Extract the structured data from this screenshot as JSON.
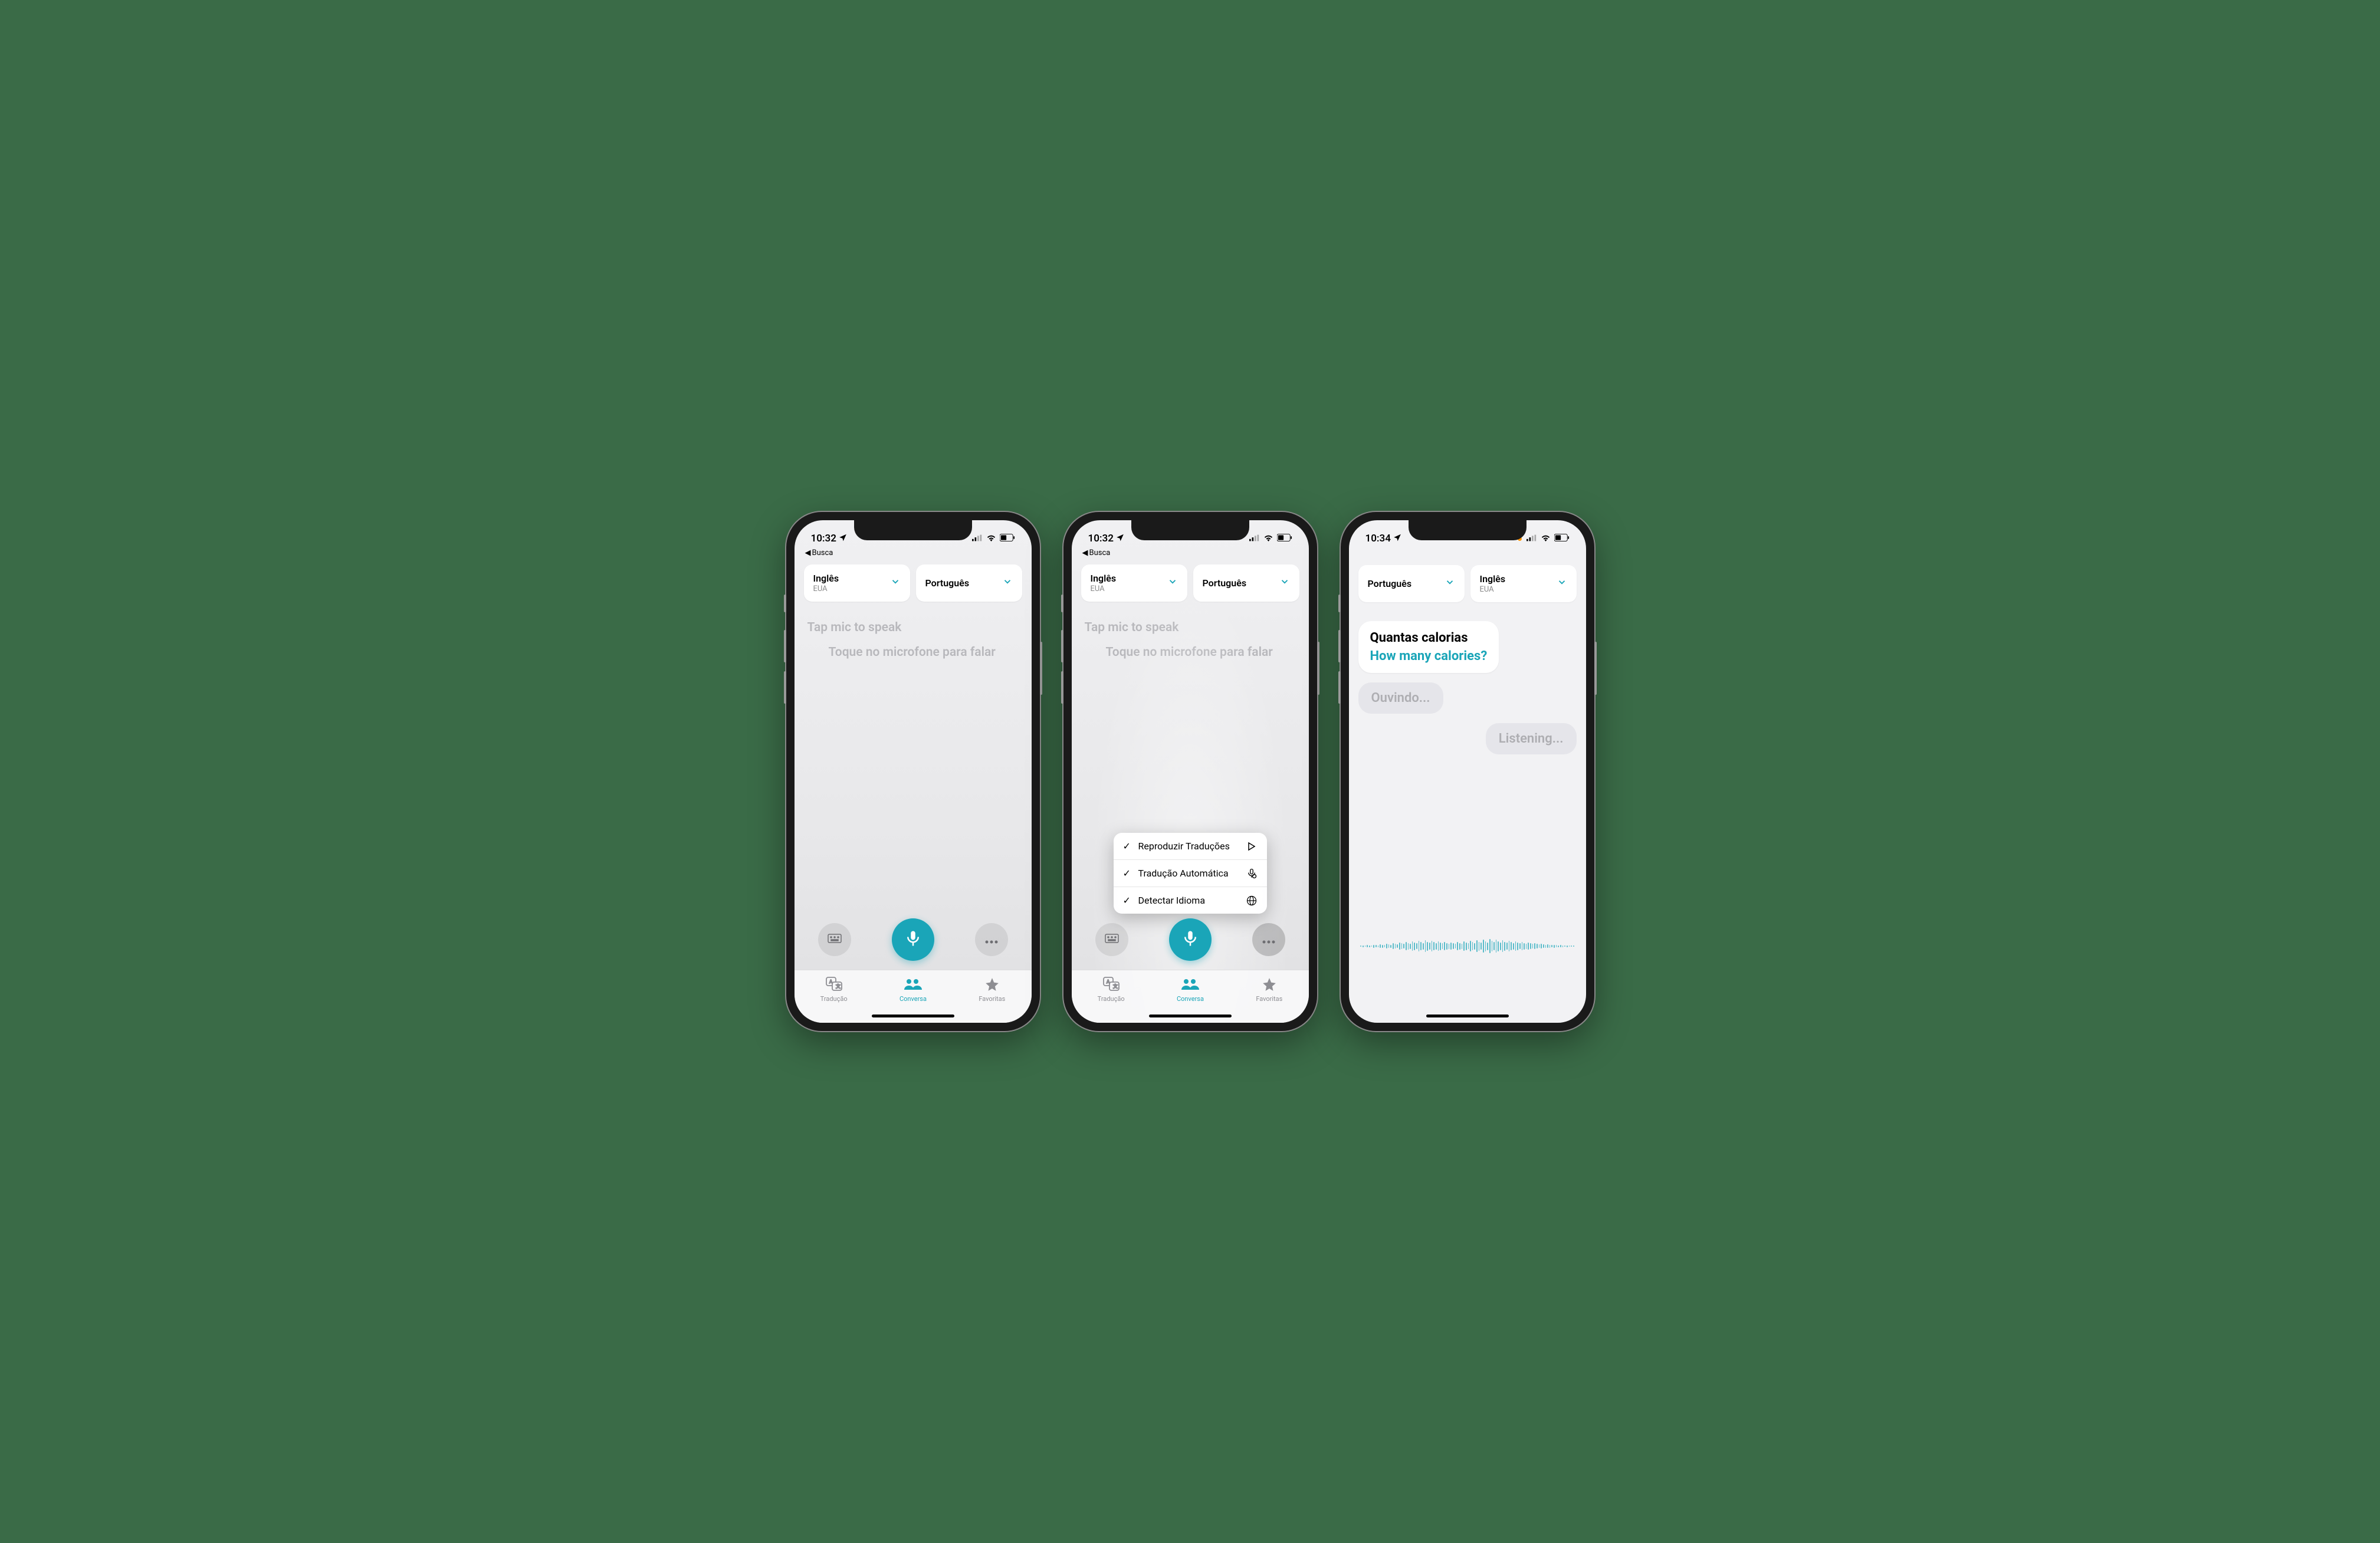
{
  "phones": [
    {
      "status": {
        "time": "10:32",
        "back_label": "Busca"
      },
      "lang_left": {
        "name": "Inglês",
        "sub": "EUA"
      },
      "lang_right": {
        "name": "Português",
        "sub": ""
      },
      "prompt1": "Tap mic to speak",
      "prompt2": "Toque no microfone para falar",
      "tabs": {
        "t1": "Tradução",
        "t2": "Conversa",
        "t3": "Favoritas"
      }
    },
    {
      "status": {
        "time": "10:32",
        "back_label": "Busca"
      },
      "lang_left": {
        "name": "Inglês",
        "sub": "EUA"
      },
      "lang_right": {
        "name": "Português",
        "sub": ""
      },
      "prompt1": "Tap mic to speak",
      "prompt2": "Toque no microfone para falar",
      "menu": {
        "item1": "Reproduzir Traduções",
        "item2": "Tradução Automática",
        "item3": "Detectar Idioma"
      },
      "tabs": {
        "t1": "Tradução",
        "t2": "Conversa",
        "t3": "Favoritas"
      }
    },
    {
      "status": {
        "time": "10:34"
      },
      "lang_left": {
        "name": "Português",
        "sub": ""
      },
      "lang_right": {
        "name": "Inglês",
        "sub": "EUA"
      },
      "bubble1": {
        "src": "Quantas calorias",
        "trans": "How many calories?"
      },
      "bubble2": "Ouvindo...",
      "bubble3": "Listening..."
    }
  ]
}
